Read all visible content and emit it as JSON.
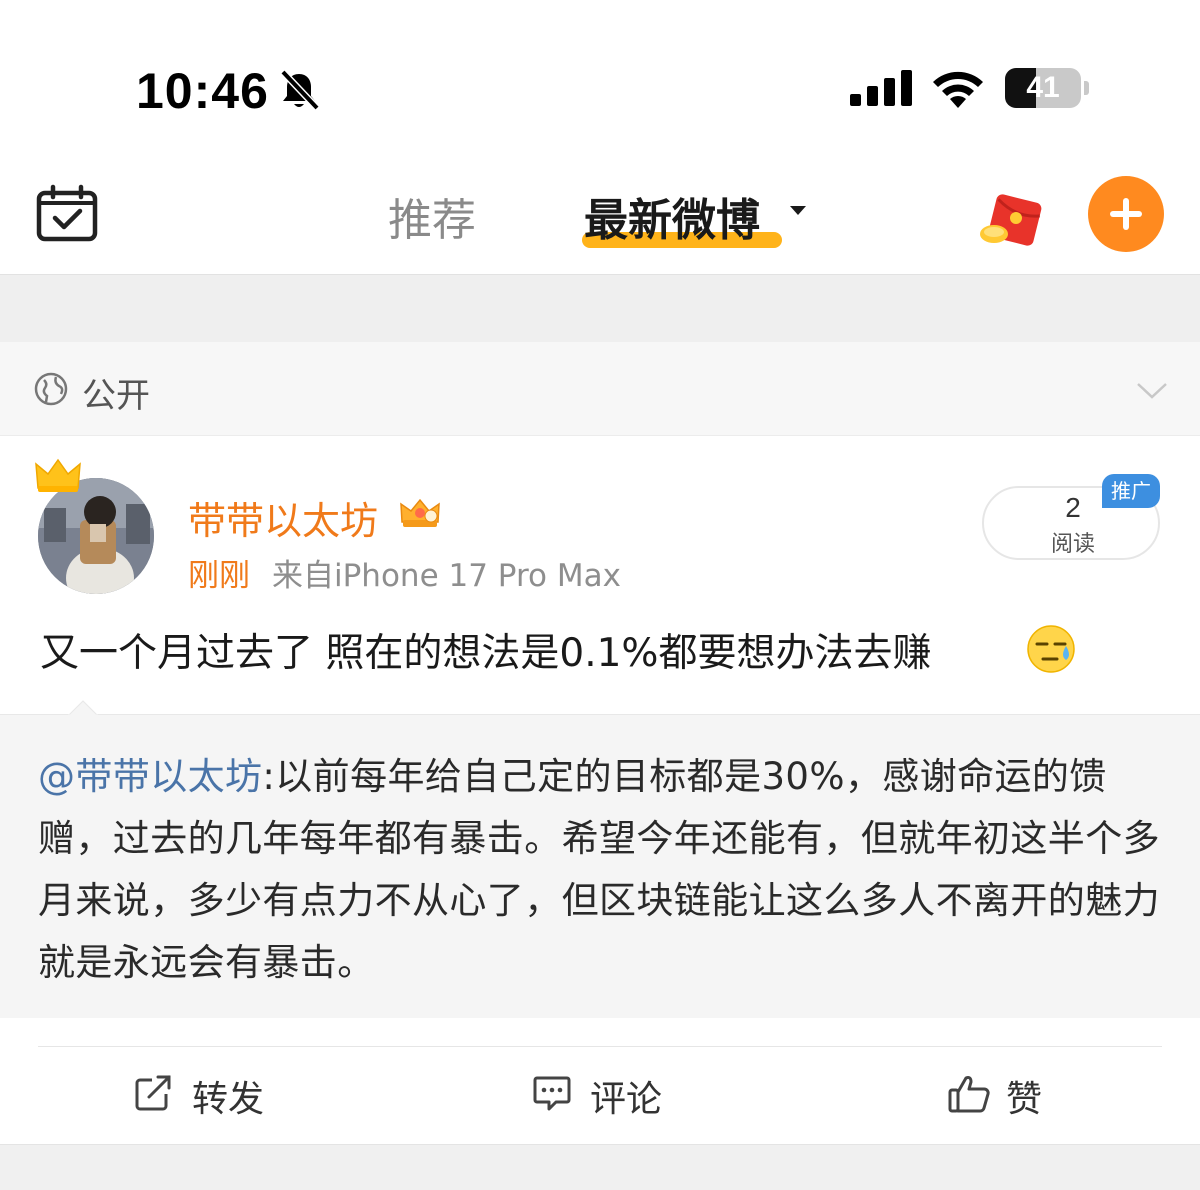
{
  "status_bar": {
    "time": "10:46",
    "battery_level": 41,
    "battery_text": "41",
    "icons": [
      "bell-off-icon",
      "cellular-signal-icon",
      "wifi-icon",
      "battery-icon"
    ]
  },
  "top_nav": {
    "tabs": [
      {
        "label": "推荐",
        "active": false
      },
      {
        "label": "最新微博",
        "active": true
      }
    ],
    "accent_color": "#ffb31a",
    "add_button_color": "#ff8a1f",
    "icons": [
      "calendar-check-icon",
      "red-packet-icon",
      "plus-icon"
    ]
  },
  "visibility": {
    "label": "公开",
    "icon": "globe-icon"
  },
  "post": {
    "username": "带带以太坊",
    "username_color": "#f07a1a",
    "time": "刚刚",
    "source": "来自iPhone 17 Pro Max",
    "read_count": "2",
    "read_label": "阅读",
    "promote_tag": "推广",
    "text": "又一个月过去了 照在的想法是0.1%都要想办法去赚",
    "emoji": "sweat-smile-emoji",
    "repost": {
      "mention": "@带带以太坊",
      "body": ":以前每年给自己定的目标都是30%，感谢命运的馈赠，过去的几年每年都有暴击。希望今年还能有，但就年初这半个多月来说，多少有点力不从心了，但区块链能让这么多人不离开的魅力就是永远会有暴击。"
    }
  },
  "actions": {
    "repost_label": "转发",
    "comment_label": "评论",
    "like_label": "赞"
  }
}
